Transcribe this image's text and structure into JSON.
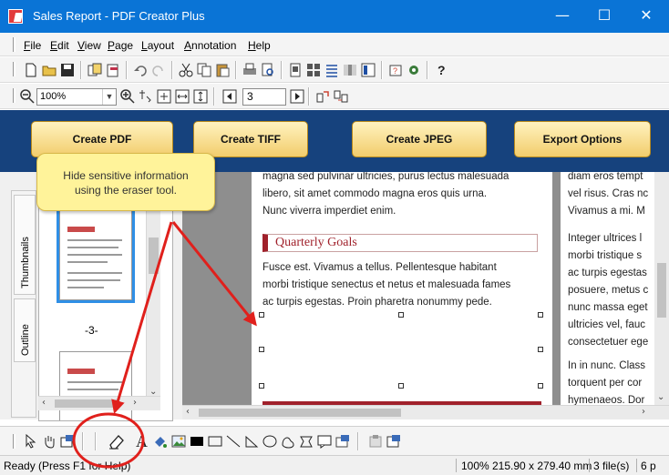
{
  "window": {
    "title": "Sales Report - PDF Creator Plus",
    "minimize_glyph": "—",
    "maximize_glyph": "☐",
    "close_glyph": "✕"
  },
  "menu": [
    {
      "key": "F",
      "rest": "ile"
    },
    {
      "key": "E",
      "rest": "dit"
    },
    {
      "key": "V",
      "rest": "iew"
    },
    {
      "key": "P",
      "rest": "age"
    },
    {
      "key": "L",
      "rest": "ayout"
    },
    {
      "key": "A",
      "rest": "nnotation"
    },
    {
      "key": "H",
      "rest": "elp"
    }
  ],
  "toolbar": {
    "zoom_value": "100%",
    "page_number": "3"
  },
  "actions": {
    "create_pdf": "Create PDF",
    "create_tiff": "Create TIFF",
    "create_jpeg": "Create JPEG",
    "export_options": "Export Options"
  },
  "side_tabs": {
    "thumbnails": "Thumbnails",
    "outline": "Outline"
  },
  "thumbnails": {
    "current_label": "-3-"
  },
  "callout": {
    "line1": "Hide sensitive information",
    "line2": "using the eraser tool."
  },
  "document": {
    "para1": [
      "magna sed pulvinar ultricies, purus lectus malesuada",
      "libero, sit amet commodo magna eros quis urna.",
      "Nunc viverra imperdiet enim."
    ],
    "section_title": "Quarterly Goals",
    "para2": [
      "Fusce est. Vivamus a tellus. Pellentesque habitant",
      "morbi tristique senectus et netus et malesuada fames",
      "ac turpis egestas. Proin pharetra nonummy pede."
    ],
    "col2": [
      "diam eros tempt",
      "vel risus. Cras nc",
      "Vivamus a mi. M",
      "",
      "Integer ultrices l",
      "morbi tristique s",
      "ac turpis egestas",
      "posuere, metus c",
      "nunc massa eget",
      "ultricies vel, fauc",
      "consectetuer ege",
      "",
      "In in nunc. Class",
      "torquent per cor",
      "hymenaeos. Dor"
    ]
  },
  "status": {
    "ready": "Ready (Press F1 for Help)",
    "zoom": "100%",
    "page_size": "215.90 x 279.40 mm",
    "files": "3 file(s)",
    "pages": "6 p"
  },
  "colors": {
    "titlebar": "#0a74d6",
    "action_band": "#16427d",
    "section_accent": "#a0212b",
    "annotation_red": "#e0201c",
    "callout_fill": "#fff39a"
  }
}
